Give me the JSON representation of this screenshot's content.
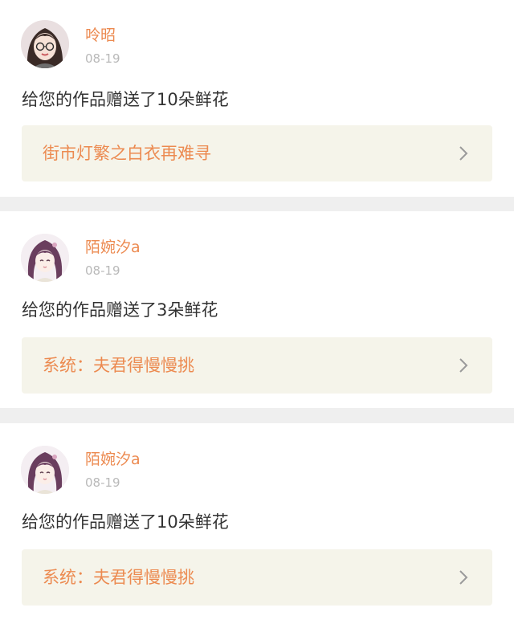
{
  "notifications": [
    {
      "username": "呤昭",
      "date": "08-19",
      "message": "给您的作品赠送了10朵鲜花",
      "work_title": "街市灯繁之白衣再难寻",
      "avatar_icon": "avatar-girl-icon"
    },
    {
      "username": "陌婉汐a",
      "date": "08-19",
      "message": "给您的作品赠送了3朵鲜花",
      "work_title": "系统：夫君得慢慢挑",
      "avatar_icon": "avatar-anime-girl-icon"
    },
    {
      "username": "陌婉汐a",
      "date": "08-19",
      "message": "给您的作品赠送了10朵鲜花",
      "work_title": "系统：夫君得慢慢挑",
      "avatar_icon": "avatar-anime-girl-icon"
    }
  ],
  "colors": {
    "accent": "#ec8a50",
    "link_bg": "#f5f4ea",
    "page_bg": "#efefef",
    "date": "#b9b9b9"
  }
}
